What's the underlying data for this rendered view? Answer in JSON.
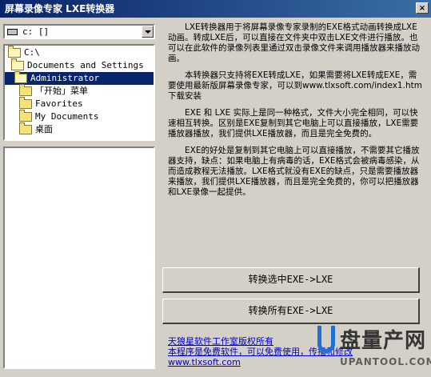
{
  "window": {
    "title": "屏幕录像专家 LXE转换器",
    "close_glyph": "×"
  },
  "drive": {
    "value": "c: []"
  },
  "tree": {
    "items": [
      {
        "label": "C:\\"
      },
      {
        "label": "Documents and Settings"
      },
      {
        "label": "Administrator"
      },
      {
        "label": "「开始」菜单"
      },
      {
        "label": "Favorites"
      },
      {
        "label": "My Documents"
      },
      {
        "label": "桌面"
      }
    ]
  },
  "description": {
    "p1": "LXE转换器用于将屏幕录像专家录制的EXE格式动画转换成LXE动画。转成LXE后，可以直接在文件夹中双击LXE文件进行播放。也可以在此软件的录像列表里通过双击录像文件来调用播放器来播放动画。",
    "p2": "本转换器只支持将EXE转成LXE，如果需要将LXE转成EXE，需要使用最新版屏幕录像专家，可以到www.tlxsoft.com/index1.htm 下载安装",
    "p3": "EXE 和 LXE 实际上是同一种格式，文件大小完全相同，可以快速相互转换。区别是EXE复制到其它电脑上可以直接播放，LXE需要播放器播放，我们提供LXE播放器，而且是完全免费的。",
    "p4": "EXE的好处是复制到其它电脑上可以直接播放，不需要其它播放器支持，缺点：如果电脑上有病毒的话，EXE格式会被病毒感染，从而造成教程无法播放。LXE格式就没有EXE的缺点，只是需要播放器来播放，我们提供LXE播放器，而且是完全免费的，你可以把播放器和LXE录像一起提供。"
  },
  "buttons": {
    "convert_selected": "转换选中EXE->LXE",
    "convert_all": "转换所有EXE->LXE"
  },
  "links": {
    "copyright": "天狼星软件工作室版权所有",
    "free": "本程序是免费软件，可以免费使用，传播和修改",
    "site": "www.tlxsoft.com"
  },
  "watermark": {
    "cn": "盘量产网",
    "en": "UPANTOOL.COM"
  }
}
